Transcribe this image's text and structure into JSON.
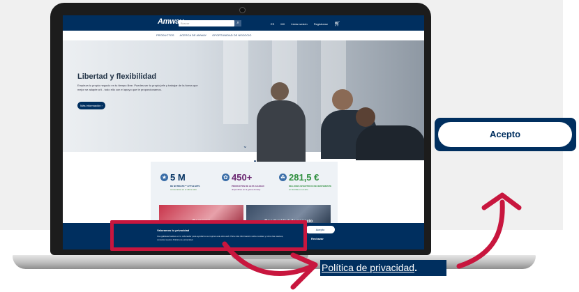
{
  "header": {
    "logo": "Amway",
    "search_placeholder": "Buscar",
    "lang": "ES",
    "region": "MX",
    "login": "Iniciar sesión",
    "register": "Registrarse"
  },
  "subnav": [
    "PRODUCTOS",
    "ACERCA DE AMWAY",
    "OPORTUNIDAD DE NEGOCIO"
  ],
  "hero": {
    "title": "Libertad y flexibilidad",
    "description": "Empieza tu propio negocio en tu tiempo libre. Puedes ser tu propio jefe y trabajar de la forma que mejor se adapte a ti - todo ello con el apoyo que te proporcionamos.",
    "button": "Más información"
  },
  "stats": [
    {
      "value": "5 M",
      "label": "DE NUTRILITE™ LITTLE BITS",
      "sub": "consumidos en el último año",
      "color": "#002f5f"
    },
    {
      "value": "450+",
      "label": "PRODUCTOS DE ALTA CALIDAD",
      "sub": "disponibles en la gama Amway",
      "color": "#6a2570"
    },
    {
      "value": "281,5 €",
      "label": "MILLONES INVERTIDOS RECIENTEMENTE",
      "sub": "en Nutrilite en el año",
      "color": "#2f8f3e"
    }
  ],
  "cards": [
    "Compras",
    "Oportunidad de negocio"
  ],
  "cookie": {
    "title": "Valoramos tu privacidad",
    "text": "Usa galletas/cookies en tu ordenador para ayudarnos a mejorar este sitio web. Para más información sobre cookies y cómo las usamos, consulta nuestra Política de privacidad.",
    "accept": "Acepto",
    "reject": "Rechazar"
  },
  "callout": {
    "accept_label": "Acepto",
    "privacy_link": "Política de privacidad",
    "privacy_suffix": ".",
    "accent_color": "#c8163e"
  }
}
